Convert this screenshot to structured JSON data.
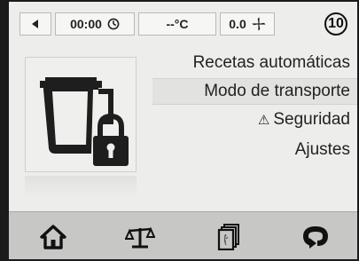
{
  "status_bar": {
    "back_icon": "triangle-left-icon",
    "time": "00:00",
    "time_icon": "clock-icon",
    "temperature": "--°C",
    "fan_speed": "0.0",
    "fan_icon": "fan-icon"
  },
  "step_number": "10",
  "device_image": "bowl-with-padlock-icon",
  "menu": {
    "items": [
      {
        "label": "Recetas automáticas"
      },
      {
        "label": "Modo de transporte",
        "selected": true
      },
      {
        "label": "Seguridad",
        "icon": "warning-icon",
        "icon_glyph": "⚠"
      },
      {
        "label": "Ajustes"
      }
    ]
  },
  "bottom_nav": {
    "items": [
      {
        "icon": "home-icon"
      },
      {
        "icon": "scale-icon"
      },
      {
        "icon": "recipe-book-icon"
      },
      {
        "icon": "turbo-icon"
      }
    ]
  }
}
